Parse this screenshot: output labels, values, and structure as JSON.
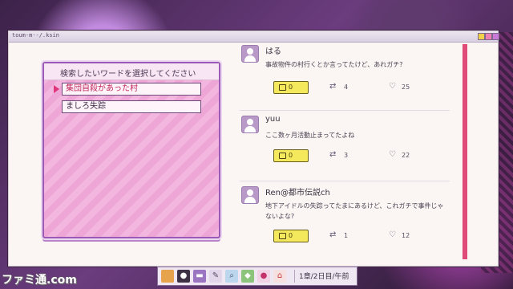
{
  "window": {
    "title": "toum·m·-/.ksin"
  },
  "search": {
    "title": "検索したいワードを選択してください",
    "options": [
      "集団自殺があった村",
      "ましろ失踪"
    ]
  },
  "posts": [
    {
      "user": "はる",
      "text": "事故物件の村行くとか言ってたけど、あれガチ?",
      "comments": "0",
      "retweets": "4",
      "likes": "25"
    },
    {
      "user": "yuu",
      "text": "ここ数ヶ月活動止まってたよね",
      "comments": "0",
      "retweets": "3",
      "likes": "22"
    },
    {
      "user": "Ren@都市伝説ch",
      "text": "地下アイドルの失踪ってたまにあるけど、これガチで事件じゃないよな?",
      "comments": "0",
      "retweets": "1",
      "likes": "12"
    }
  ],
  "taskbar": {
    "icons": [
      "folder-icon",
      "person-icon",
      "sns-icon",
      "chat-icon",
      "search-icon",
      "map-icon",
      "balloon-icon",
      "home-icon"
    ],
    "status": "1章/2日目/午前"
  },
  "watermark": "ファミ通.com",
  "colors": {
    "accent": "#e04a76",
    "panel": "#f3b7df",
    "button": "#f4e95c"
  }
}
